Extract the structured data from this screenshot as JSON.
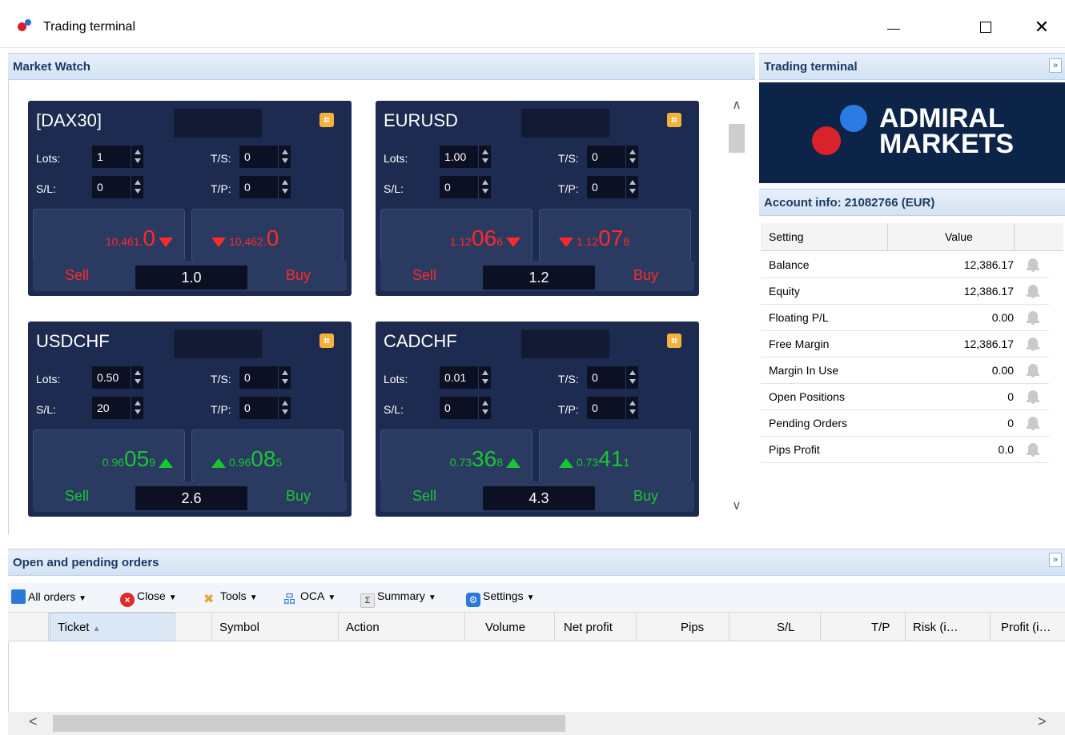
{
  "window": {
    "title": "Trading terminal"
  },
  "market_watch": {
    "title": "Market Watch",
    "cards": [
      {
        "symbol": "[DAX30]",
        "lots_label": "Lots:",
        "lots": "1",
        "ts_label": "T/S:",
        "ts": "0",
        "sl_label": "S/L:",
        "sl": "0",
        "tp_label": "T/P:",
        "tp": "0",
        "sell_small": "10,461.",
        "sell_big": "0",
        "sell_tail": "",
        "buy_small": "10,462.",
        "buy_big": "0",
        "buy_tail": "",
        "direction": "down",
        "sell_label": "Sell",
        "buy_label": "Buy",
        "spread": "1.0"
      },
      {
        "symbol": "EURUSD",
        "lots_label": "Lots:",
        "lots": "1.00",
        "ts_label": "T/S:",
        "ts": "0",
        "sl_label": "S/L:",
        "sl": "0",
        "tp_label": "T/P:",
        "tp": "0",
        "sell_small": "1.12",
        "sell_big": "06",
        "sell_tail": "6",
        "buy_small": "1.12",
        "buy_big": "07",
        "buy_tail": "8",
        "direction": "down",
        "sell_label": "Sell",
        "buy_label": "Buy",
        "spread": "1.2"
      },
      {
        "symbol": "USDCHF",
        "lots_label": "Lots:",
        "lots": "0.50",
        "ts_label": "T/S:",
        "ts": "0",
        "sl_label": "S/L:",
        "sl": "20",
        "tp_label": "T/P:",
        "tp": "0",
        "sell_small": "0.96",
        "sell_big": "05",
        "sell_tail": "9",
        "buy_small": "0.96",
        "buy_big": "08",
        "buy_tail": "5",
        "direction": "up",
        "sell_label": "Sell",
        "buy_label": "Buy",
        "spread": "2.6"
      },
      {
        "symbol": "CADCHF",
        "lots_label": "Lots:",
        "lots": "0.01",
        "ts_label": "T/S:",
        "ts": "0",
        "sl_label": "S/L:",
        "sl": "0",
        "tp_label": "T/P:",
        "tp": "0",
        "sell_small": "0.73",
        "sell_big": "36",
        "sell_tail": "8",
        "buy_small": "0.73",
        "buy_big": "41",
        "buy_tail": "1",
        "direction": "up",
        "sell_label": "Sell",
        "buy_label": "Buy",
        "spread": "4.3"
      }
    ]
  },
  "terminal_panel": {
    "title": "Trading terminal",
    "collapse_icon": "double-chevron-right-icon",
    "logo_line1": "ADMIRAL",
    "logo_line2": "MARKETS",
    "account_title": "Account info: 21082766 (EUR)",
    "col_setting": "Setting",
    "col_value": "Value",
    "rows": [
      {
        "key": "Balance",
        "value": "12,386.17"
      },
      {
        "key": "Equity",
        "value": "12,386.17"
      },
      {
        "key": "Floating P/L",
        "value": "0.00"
      },
      {
        "key": "Free Margin",
        "value": "12,386.17"
      },
      {
        "key": "Margin In Use",
        "value": "0.00"
      },
      {
        "key": "Open Positions",
        "value": "0"
      },
      {
        "key": "Pending Orders",
        "value": "0"
      },
      {
        "key": "Pips Profit",
        "value": "0.0"
      }
    ]
  },
  "orders_panel": {
    "title": "Open and pending orders",
    "toolbar": [
      {
        "label": "All orders",
        "icon": "list-icon"
      },
      {
        "label": "Close",
        "icon": "close-icon"
      },
      {
        "label": "Tools",
        "icon": "tools-icon"
      },
      {
        "label": "OCA",
        "icon": "hierarchy-icon"
      },
      {
        "label": "Summary",
        "icon": "sigma-icon"
      },
      {
        "label": "Settings",
        "icon": "gear-icon"
      }
    ],
    "columns": [
      "Ticket",
      "Symbol",
      "Action",
      "Volume",
      "Net profit",
      "Pips",
      "S/L",
      "T/P",
      "Risk (i…",
      "Profit (i…"
    ]
  },
  "colors": {
    "card_bg": "#1c2b4f",
    "sell_red": "#ff2a2a",
    "buy_green": "#19c632",
    "header_blue": "#1c3a63"
  }
}
